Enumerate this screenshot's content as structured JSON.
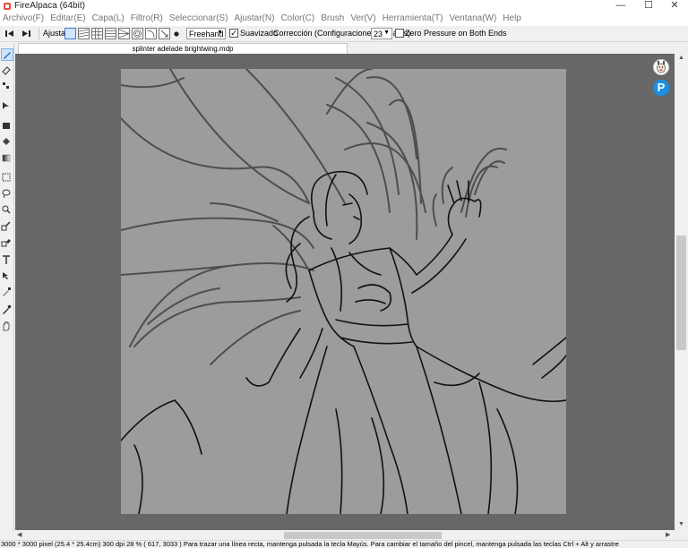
{
  "window": {
    "title": "FireAlpaca (64bit)",
    "minimize": "—",
    "maximize": "☐",
    "close": "✕"
  },
  "menu": [
    "Archivo(F)",
    "Editar(E)",
    "Capa(L)",
    "Filtro(R)",
    "Seleccionar(S)",
    "Ajustar(N)",
    "Color(C)",
    "Brush",
    "Ver(V)",
    "Herramienta(T)",
    "Ventana(W)",
    "Help"
  ],
  "toolbar": {
    "adjust_label": "Ajustar",
    "mode_value": "Freehand",
    "smoothing_label": "Suavizado",
    "correction_label": "Corrección (Configuraciones globales)",
    "correction_value": "23",
    "zero_pressure_label": "Zero Pressure on Both Ends"
  },
  "document": {
    "tab_title": "splinter adelade brightwing.mdp"
  },
  "status": {
    "text": "3000 * 3000 pixel   (25.4 * 25.4cm)   300 dpi   28 %   ( 617, 3033 )   Para trazar una línea recta, mantenga pulsada la tecla Mayús. Para cambiar el tamaño del pincel, mantenga pulsada las teclas Ctrl + Alt y arrastre"
  },
  "colors": {
    "workspace": "#676767",
    "canvas": "#9c9c9c",
    "accent": "#3b7fd6",
    "plugin_blue": "#1a8fe3"
  },
  "icons": {
    "plugin_1": "alpaca-icon",
    "plugin_2": "p-letter-icon"
  },
  "plugin_letter": "P"
}
